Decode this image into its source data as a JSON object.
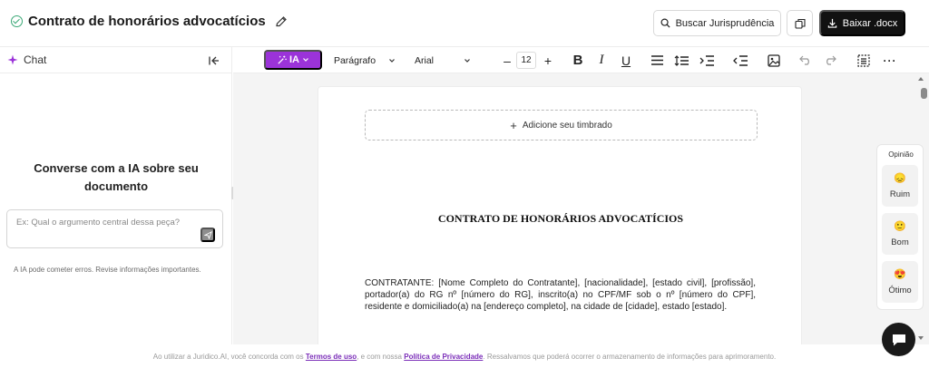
{
  "header": {
    "title": "Contrato de honorários advocatícios",
    "search_button": "Buscar Jurisprudência",
    "download_button": "Baixar .docx"
  },
  "chat": {
    "label": "Chat",
    "heading": "Converse com a IA sobre seu documento",
    "input_placeholder": "Ex: Qual o argumento central dessa peça?",
    "disclaimer": "A IA pode cometer erros. Revise informações importantes."
  },
  "toolbar": {
    "ia_label": "IA",
    "paragraph_style": "Parágrafo",
    "font_family": "Arial",
    "font_size": "12"
  },
  "document": {
    "letterhead_label": "Adicione seu timbrado",
    "title": "CONTRATO DE HONORÁRIOS ADVOCATÍCIOS",
    "body": "CONTRATANTE: [Nome Completo do Contratante], [nacionalidade], [estado civil], [profissão], portador(a) do RG nº [número do RG], inscrito(a) no CPF/MF sob o nº [número do CPF], residente e domiciliado(a) na [endereço completo], na cidade de [cidade], estado [estado]."
  },
  "feedback": {
    "title": "Opinião",
    "items": [
      {
        "label": "Ruim",
        "emoji": "😞"
      },
      {
        "label": "Bom",
        "emoji": "🙂"
      },
      {
        "label": "Ótimo",
        "emoji": "😍"
      }
    ]
  },
  "footer": {
    "prefix": "Ao utilizar a Juridico.AI, você concorda com os",
    "terms_link": "Termos de uso",
    "middle": ", e com nossa",
    "privacy_link": "Política de Privacidade",
    "suffix": ". Ressalvamos que poderá ocorrer o armazenamento de informações para aprimoramento."
  },
  "colors": {
    "accent": "#9b33d9",
    "primary_button": "#111111",
    "link": "#7a2cb8"
  }
}
